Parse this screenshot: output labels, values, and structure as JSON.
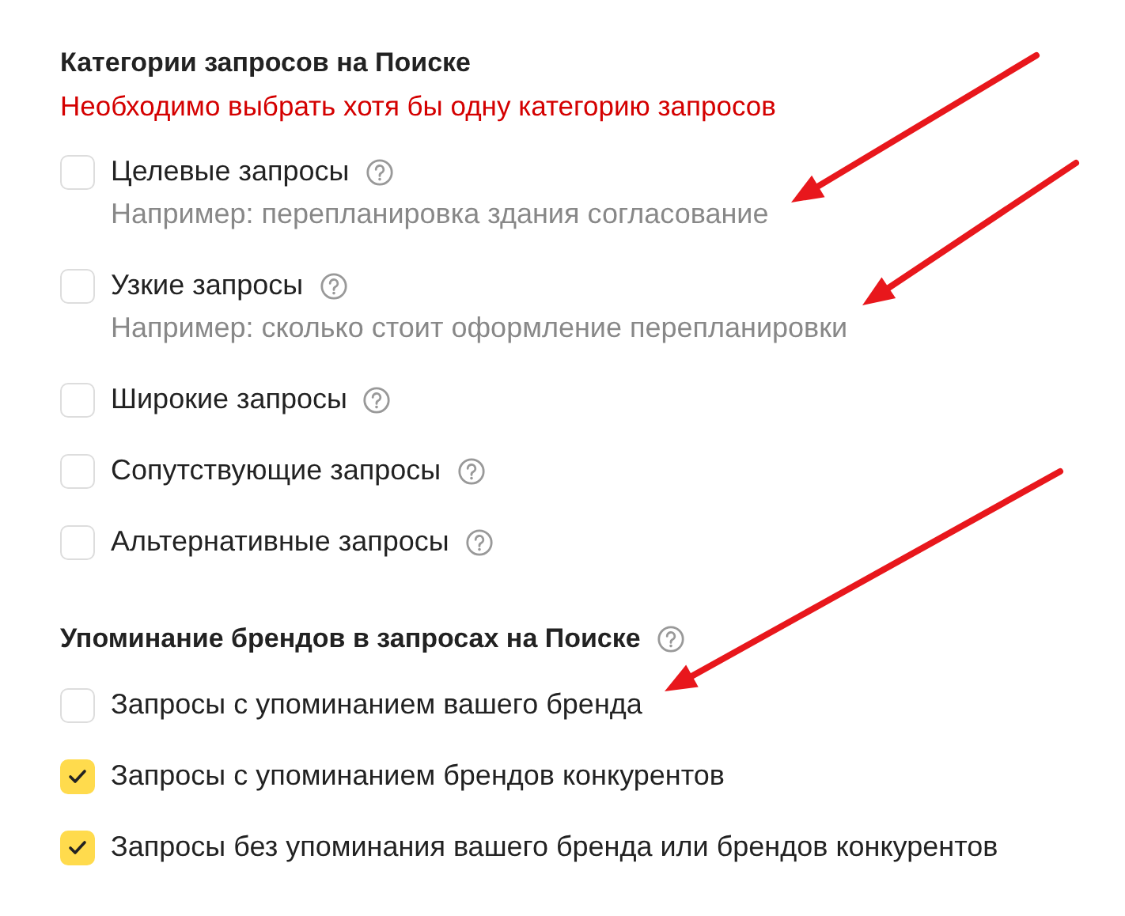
{
  "sections": [
    {
      "title": "Категории запросов на Поиске",
      "title_help": false,
      "error": "Необходимо выбрать хотя бы одну категорию запросов",
      "options": [
        {
          "label": "Целевые запросы",
          "help": true,
          "hint": "Например: перепланировка здания согласование",
          "checked": false
        },
        {
          "label": "Узкие запросы",
          "help": true,
          "hint": "Например: сколько стоит оформление перепланировки",
          "checked": false
        },
        {
          "label": "Широкие запросы",
          "help": true,
          "checked": false
        },
        {
          "label": "Сопутствующие запросы",
          "help": true,
          "checked": false
        },
        {
          "label": "Альтернативные запросы",
          "help": true,
          "checked": false
        }
      ]
    },
    {
      "title": "Упоминание брендов в запросах на Поиске",
      "title_help": true,
      "options": [
        {
          "label": "Запросы с упоминанием вашего бренда",
          "help": false,
          "checked": false
        },
        {
          "label": "Запросы с упоминанием брендов конкурентов",
          "help": false,
          "checked": true
        },
        {
          "label": "Запросы без упоминания вашего бренда или брендов конкурентов",
          "help": false,
          "checked": true
        }
      ]
    }
  ]
}
